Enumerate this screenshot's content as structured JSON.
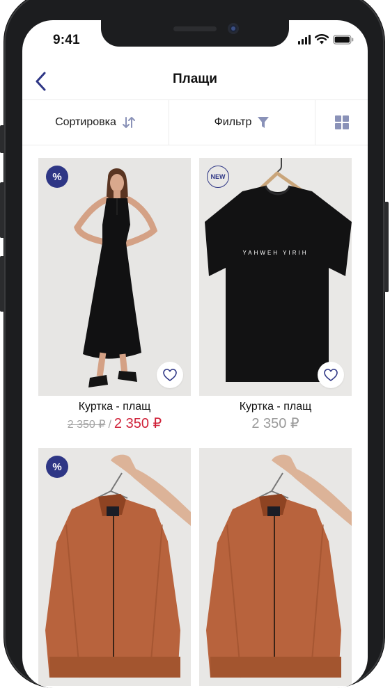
{
  "status_bar": {
    "time": "9:41"
  },
  "header": {
    "title": "Плащи"
  },
  "toolbar": {
    "sort_label": "Сортировка",
    "filter_label": "Фильтр"
  },
  "products": [
    {
      "badge": "%",
      "name": "Куртка - плащ",
      "old_price": "2 350 ₽",
      "separator": "/",
      "price": "2 350 ₽"
    },
    {
      "badge": "NEW",
      "name": "Куртка - плащ",
      "price": "2 350 ₽",
      "print_text": "YAHWEH YIRIH"
    },
    {
      "badge": "%"
    },
    {
      "badge": ""
    }
  ],
  "colors": {
    "accent": "#2E3685",
    "sale_price": "#D0233A",
    "muted_price": "#9A9A9A"
  }
}
